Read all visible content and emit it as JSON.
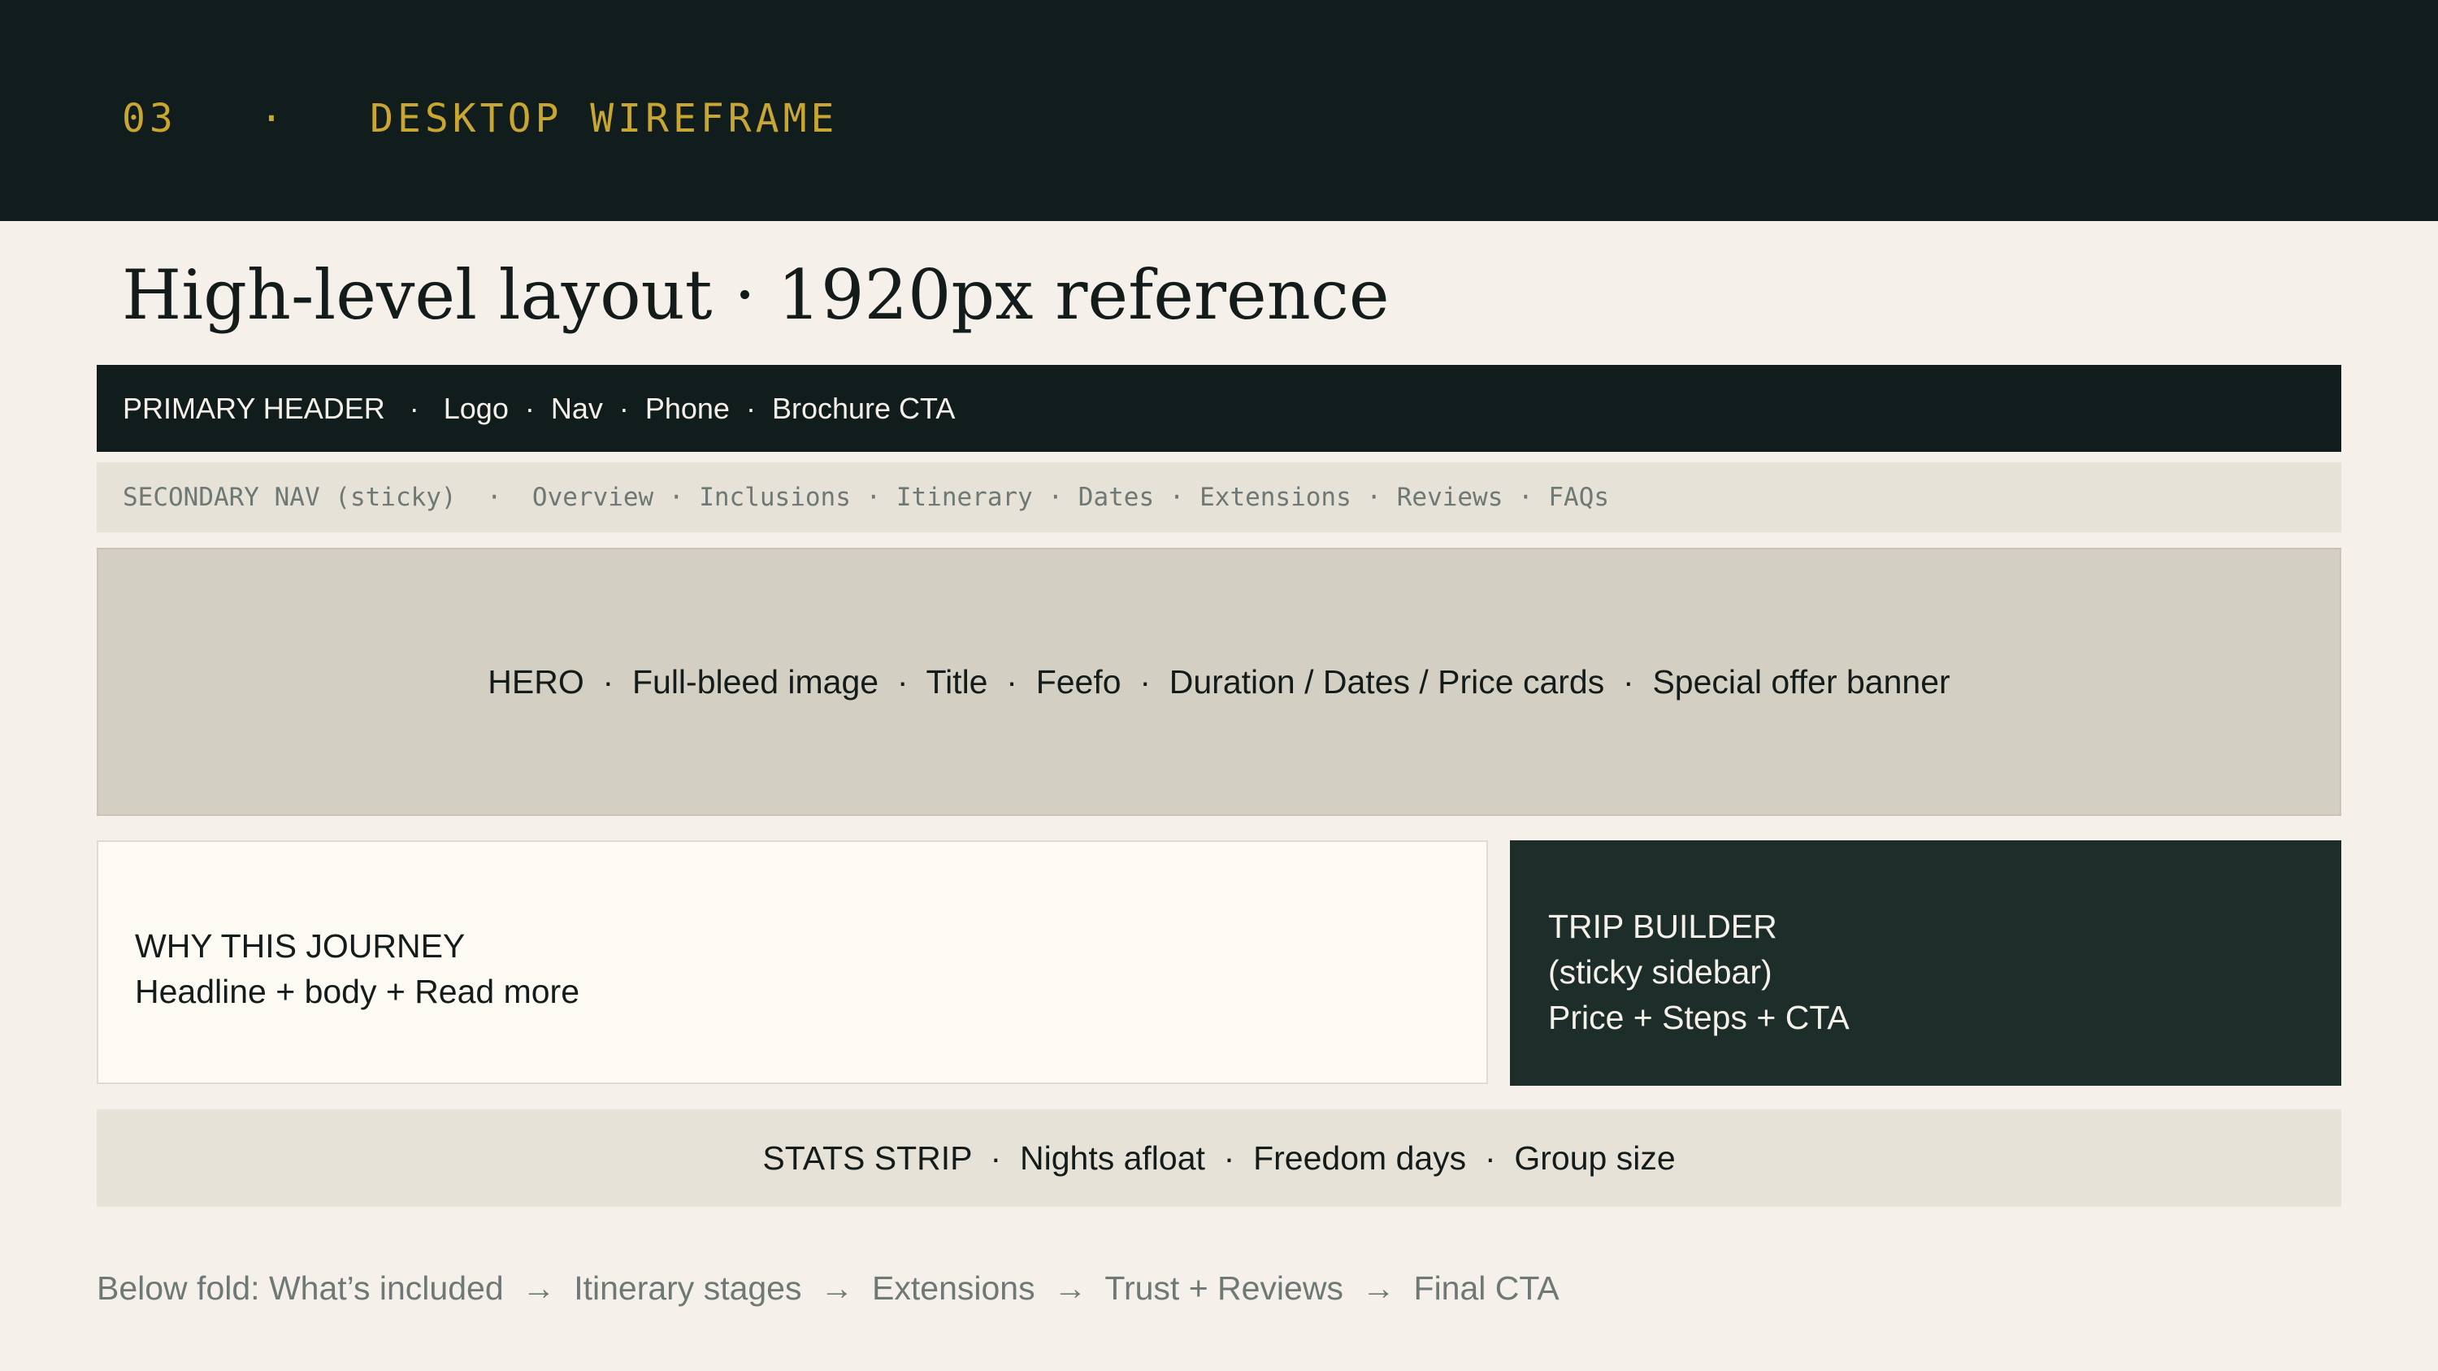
{
  "kicker": "03   ·   DESKTOP WIREFRAME",
  "title": "High-level layout · 1920px reference",
  "primary_header": "PRIMARY HEADER   ·   Logo  ·  Nav  ·  Phone  ·  Brochure CTA",
  "secondary_nav": "SECONDARY NAV (sticky)  ·  Overview · Inclusions · Itinerary · Dates · Extensions · Reviews · FAQs",
  "hero": "HERO  ·  Full-bleed image  ·  Title  ·  Feefo  ·  Duration / Dates / Price cards  ·  Special offer banner",
  "why_journey": {
    "line1": "WHY THIS JOURNEY",
    "line2": "Headline + body + Read more"
  },
  "trip_builder": {
    "line1": "TRIP BUILDER",
    "line2": "(sticky sidebar)",
    "line3": "Price + Steps + CTA"
  },
  "stats_strip": "STATS STRIP  ·  Nights afloat  ·  Freedom days  ·  Group size",
  "below_fold": "Below fold: What’s included  →  Itinerary stages  →  Extensions  →  Trust + Reviews  →  Final CTA",
  "colors": {
    "dark": "#111d1c",
    "accent": "#c9a532",
    "background": "#f5f1ea",
    "hero_fill": "#d4cfc3",
    "sidebar_fill": "#1c2d2a"
  }
}
